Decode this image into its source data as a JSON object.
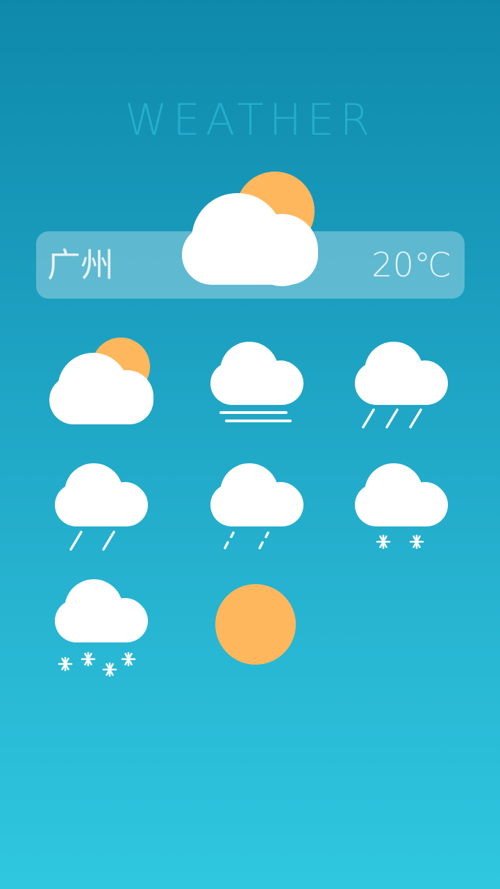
{
  "header": {
    "title": "WEATHER"
  },
  "current": {
    "city": "广州",
    "temperature": "20℃",
    "icon": "partly-cloudy-icon"
  },
  "forecast_icons": [
    "partly-cloudy-icon",
    "fog-icon",
    "heavy-rain-icon",
    "light-rain-icon",
    "drizzle-icon",
    "light-snow-icon",
    "heavy-snow-icon",
    "sunny-icon"
  ],
  "colors": {
    "background_top": "#0e89ab",
    "background_bottom": "#2fc7e0",
    "title": "#23afcf",
    "sun": "#ffb75e",
    "cloud": "#ffffff",
    "card": "rgba(255,255,255,0.30)",
    "text": "#e7f2f5"
  }
}
